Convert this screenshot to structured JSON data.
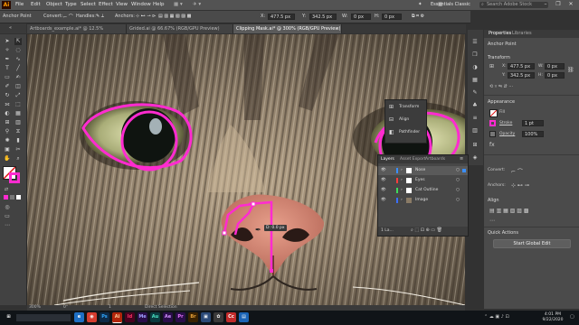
{
  "menubar": {
    "logo": "Ai",
    "items": [
      "File",
      "Edit",
      "Object",
      "Type",
      "Select",
      "Effect",
      "View",
      "Window",
      "Help"
    ],
    "workspace": "Essentials Classic",
    "search_placeholder": "Search Adobe Stock",
    "window_controls": [
      "–",
      "❐",
      "✕"
    ]
  },
  "control_bar": {
    "mode_label": "Anchor Point",
    "convert_label": "Convert:",
    "handles_label": "Handles:",
    "anchors_label": "Anchors:",
    "x_label": "X:",
    "x_value": "477.5 px",
    "y_label": "Y:",
    "y_value": "342.5 px",
    "w_label": "W:",
    "w_value": "0 px",
    "h_label": "H:",
    "h_value": "0 px"
  },
  "tabs": [
    {
      "label": "Artboards_example.ai* @ 12.5% (RGB/GPU Trim View)",
      "active": false
    },
    {
      "label": "Grided.ai @ 66.67% (RGB/GPU Preview)",
      "active": false
    },
    {
      "label": "Clipping Mask.ai* @ 300% (RGB/GPU Preview)",
      "active": true
    }
  ],
  "canvas": {
    "measure_label": "D: 0.0 px",
    "colors": {
      "path": "#ff2bd0",
      "nose": "#d98a7a"
    }
  },
  "statusbar": {
    "zoom": "300%",
    "rotation": "0°",
    "artboard": "1",
    "mode": "Direct Selection"
  },
  "flyout": {
    "items": [
      "Transform",
      "Align",
      "Pathfinder"
    ]
  },
  "layers_panel": {
    "tabs": [
      "Layers",
      "Asset Export",
      "Artboards"
    ],
    "rows": [
      {
        "name": "Nose",
        "selected": true
      },
      {
        "name": "Eyes",
        "selected": false
      },
      {
        "name": "Cat Outline",
        "selected": false
      },
      {
        "name": "Image",
        "selected": false
      }
    ],
    "footer": "1 La..."
  },
  "right_panel": {
    "tabs": [
      "Properties",
      "Libraries"
    ],
    "section_title": "Anchor Point",
    "transform_title": "Transform",
    "x_label": "X:",
    "x_value": "477.5 px",
    "y_label": "Y:",
    "y_value": "342.5 px",
    "w_label": "W:",
    "w_value": "0 px",
    "h_label": "H:",
    "h_value": "0 px",
    "appearance_title": "Appearance",
    "fill_label": "Fill",
    "stroke_label": "Stroke",
    "stroke_value": "1 pt",
    "opacity_label": "Opacity",
    "opacity_value": "100%",
    "convert_label": "Convert:",
    "anchors_label": "Anchors:",
    "align_title": "Align",
    "quick_actions_title": "Quick Actions",
    "global_edit_label": "Start Global Edit",
    "stroke_color": "#ff2bd0"
  },
  "taskbar": {
    "apps": [
      {
        "label": "⊞",
        "color": "#101418"
      },
      {
        "label": "e",
        "color": "#1e6fc4"
      },
      {
        "label": "◉",
        "color": "#d63c2e"
      },
      {
        "label": "Ps",
        "color": "#0e2a47"
      },
      {
        "label": "Ai",
        "color": "#b1250a"
      },
      {
        "label": "Id",
        "color": "#49021f"
      },
      {
        "label": "Me",
        "color": "#2a0d4a"
      },
      {
        "label": "Au",
        "color": "#0b3a3f"
      },
      {
        "label": "Ae",
        "color": "#2a0d4a"
      },
      {
        "label": "Pr",
        "color": "#2a0d4a"
      },
      {
        "label": "Br",
        "color": "#3a2200"
      },
      {
        "label": "▣",
        "color": "#2b4a78"
      },
      {
        "label": "✿",
        "color": "#3a3a3a"
      },
      {
        "label": "Cc",
        "color": "#c22a2a"
      },
      {
        "label": "▤",
        "color": "#1b64b6"
      }
    ],
    "time": "4:01 PM",
    "date": "9/22/2020"
  }
}
